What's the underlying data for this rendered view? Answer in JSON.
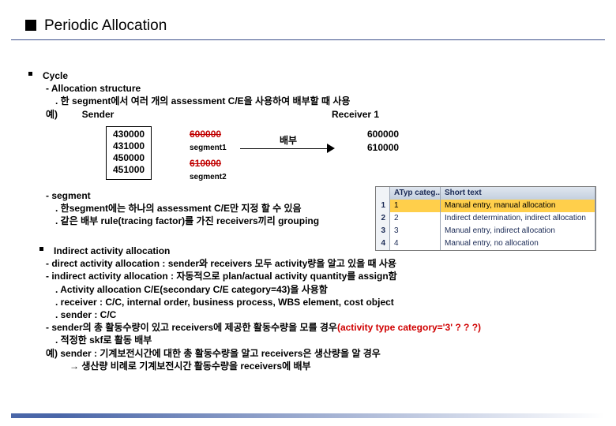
{
  "title": "Periodic Allocation",
  "section1": {
    "bullet": "Cycle",
    "l1": "- Allocation structure",
    "l2": ". 한 segment에서 여러 개의 assessment C/E을 사용하여 배부할 때 사용",
    "ex_label": "예)",
    "sender_label": "Sender",
    "receiver_label": "Receiver 1"
  },
  "sender_box": {
    "v1": "430000",
    "v2": "431000",
    "v3": "450000",
    "v4": "451000"
  },
  "segments": {
    "s1_val": "600000",
    "s1_lab": "segment1",
    "s2_val": "610000",
    "s2_lab": "segment2"
  },
  "arrow_label": "배부",
  "receiver_box": {
    "v1": "600000",
    "v2": "610000"
  },
  "seg_section": {
    "l1": "- segment",
    "l2": ". 한segment에는 하나의 assessment C/E만 지정 할 수 있음",
    "l3": ". 같은 배부 rule(tracing factor)를 가진 receivers끼리 grouping"
  },
  "table": {
    "h1": "ATyp categ...",
    "h2": "Short text",
    "rows": [
      {
        "idx": "1",
        "a": "1",
        "b": "Manual entry, manual allocation",
        "sel": true
      },
      {
        "idx": "2",
        "a": "2",
        "b": "Indirect determination, indirect allocation",
        "sel": false
      },
      {
        "idx": "3",
        "a": "3",
        "b": "Manual entry, indirect allocation",
        "sel": false
      },
      {
        "idx": "4",
        "a": "4",
        "b": "Manual entry, no allocation",
        "sel": false
      }
    ]
  },
  "iaa": {
    "head": "Indirect activity allocation",
    "l1": "- direct activity allocation : sender와 receivers 모두 activity량을 알고 있을 때 사용",
    "l2": "- indirect activity allocation : 자동적으로 plan/actual activity quantity를 assign함",
    "l3": ". Activity allocation C/E(secondary C/E category=43)을 사용함",
    "l4": ". receiver : C/C, internal order, business process, WBS element, cost object",
    "l5": ". sender : C/C",
    "l6a": "- sender의 총 활동수량이 있고 receivers에 제공한 활동수량을 모를 경우",
    "l6b": "(activity type category='3' ? ? ?)",
    "l7": ". 적정한 skf로 활동 배부",
    "l8": "예) sender : 기계보전시간에 대한 총 활동수량을 알고 receivers은 생산량을 알 경우",
    "l9": "→ 생산량 비례로 기계보전시간 활동수량을 receivers에 배부"
  }
}
